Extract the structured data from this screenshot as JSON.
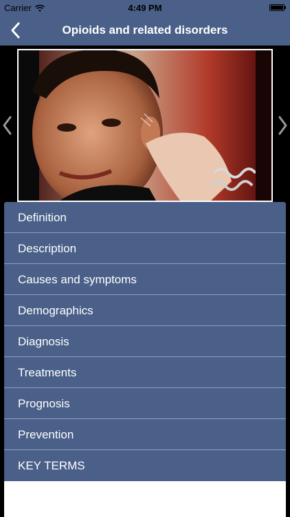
{
  "status_bar": {
    "carrier": "Carrier",
    "time": "4:49 PM"
  },
  "nav": {
    "title": "Opioids and related disorders"
  },
  "sections": [
    {
      "label": "Definition"
    },
    {
      "label": "Description"
    },
    {
      "label": "Causes and symptoms"
    },
    {
      "label": "Demographics"
    },
    {
      "label": "Diagnosis"
    },
    {
      "label": "Treatments"
    },
    {
      "label": "Prognosis"
    },
    {
      "label": "Prevention"
    },
    {
      "label": "KEY TERMS"
    }
  ],
  "colors": {
    "bar": "#4a6088",
    "row": "#4a6088",
    "separator": "#8fa0bf"
  },
  "icons": {
    "back": "chevron-left-icon",
    "prev": "chevron-left-icon",
    "next": "chevron-right-icon",
    "wifi": "wifi-icon",
    "battery": "battery-icon"
  }
}
